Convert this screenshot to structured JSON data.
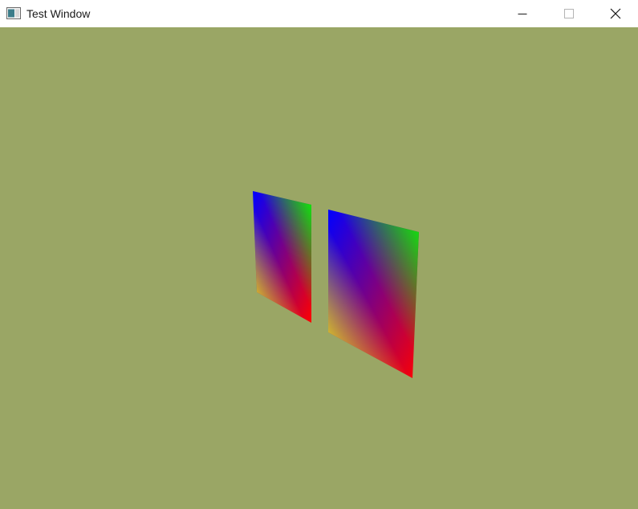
{
  "window": {
    "title": "Test Window",
    "icon": "app-window-icon",
    "controls": {
      "minimize": "minimize-icon",
      "maximize": "maximize-icon",
      "close": "close-icon"
    }
  },
  "scene": {
    "background_color": "#9aa665",
    "vertex_colors": {
      "top_left": "#0000ff",
      "top_right": "#00ff00",
      "bottom_left": "#ffff00",
      "bottom_right": "#ff0000"
    },
    "objects": [
      {
        "name": "left-quad",
        "kind": "gradient-quad"
      },
      {
        "name": "right-quad",
        "kind": "gradient-quad"
      }
    ]
  }
}
